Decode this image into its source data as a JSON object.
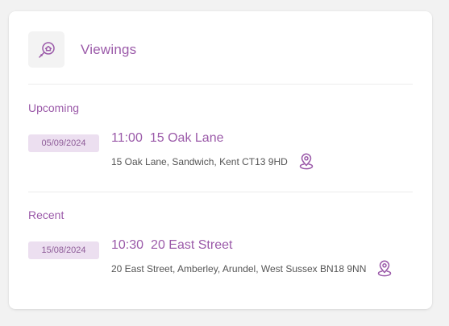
{
  "card": {
    "title": "Viewings",
    "icon": "house-search-icon",
    "accent_color": "#9b5aa9"
  },
  "sections": [
    {
      "title": "Upcoming",
      "items": [
        {
          "date": "05/09/2024",
          "time": "11:00",
          "street": "15 Oak Lane",
          "address": "15 Oak Lane, Sandwich, Kent CT13 9HD",
          "icon": "location-pin-icon"
        }
      ]
    },
    {
      "title": "Recent",
      "items": [
        {
          "date": "15/08/2024",
          "time": "10:30",
          "street": "20 East Street",
          "address": "20 East Street, Amberley, Arundel, West Sussex BN18 9NN",
          "icon": "location-pin-icon"
        }
      ]
    }
  ]
}
